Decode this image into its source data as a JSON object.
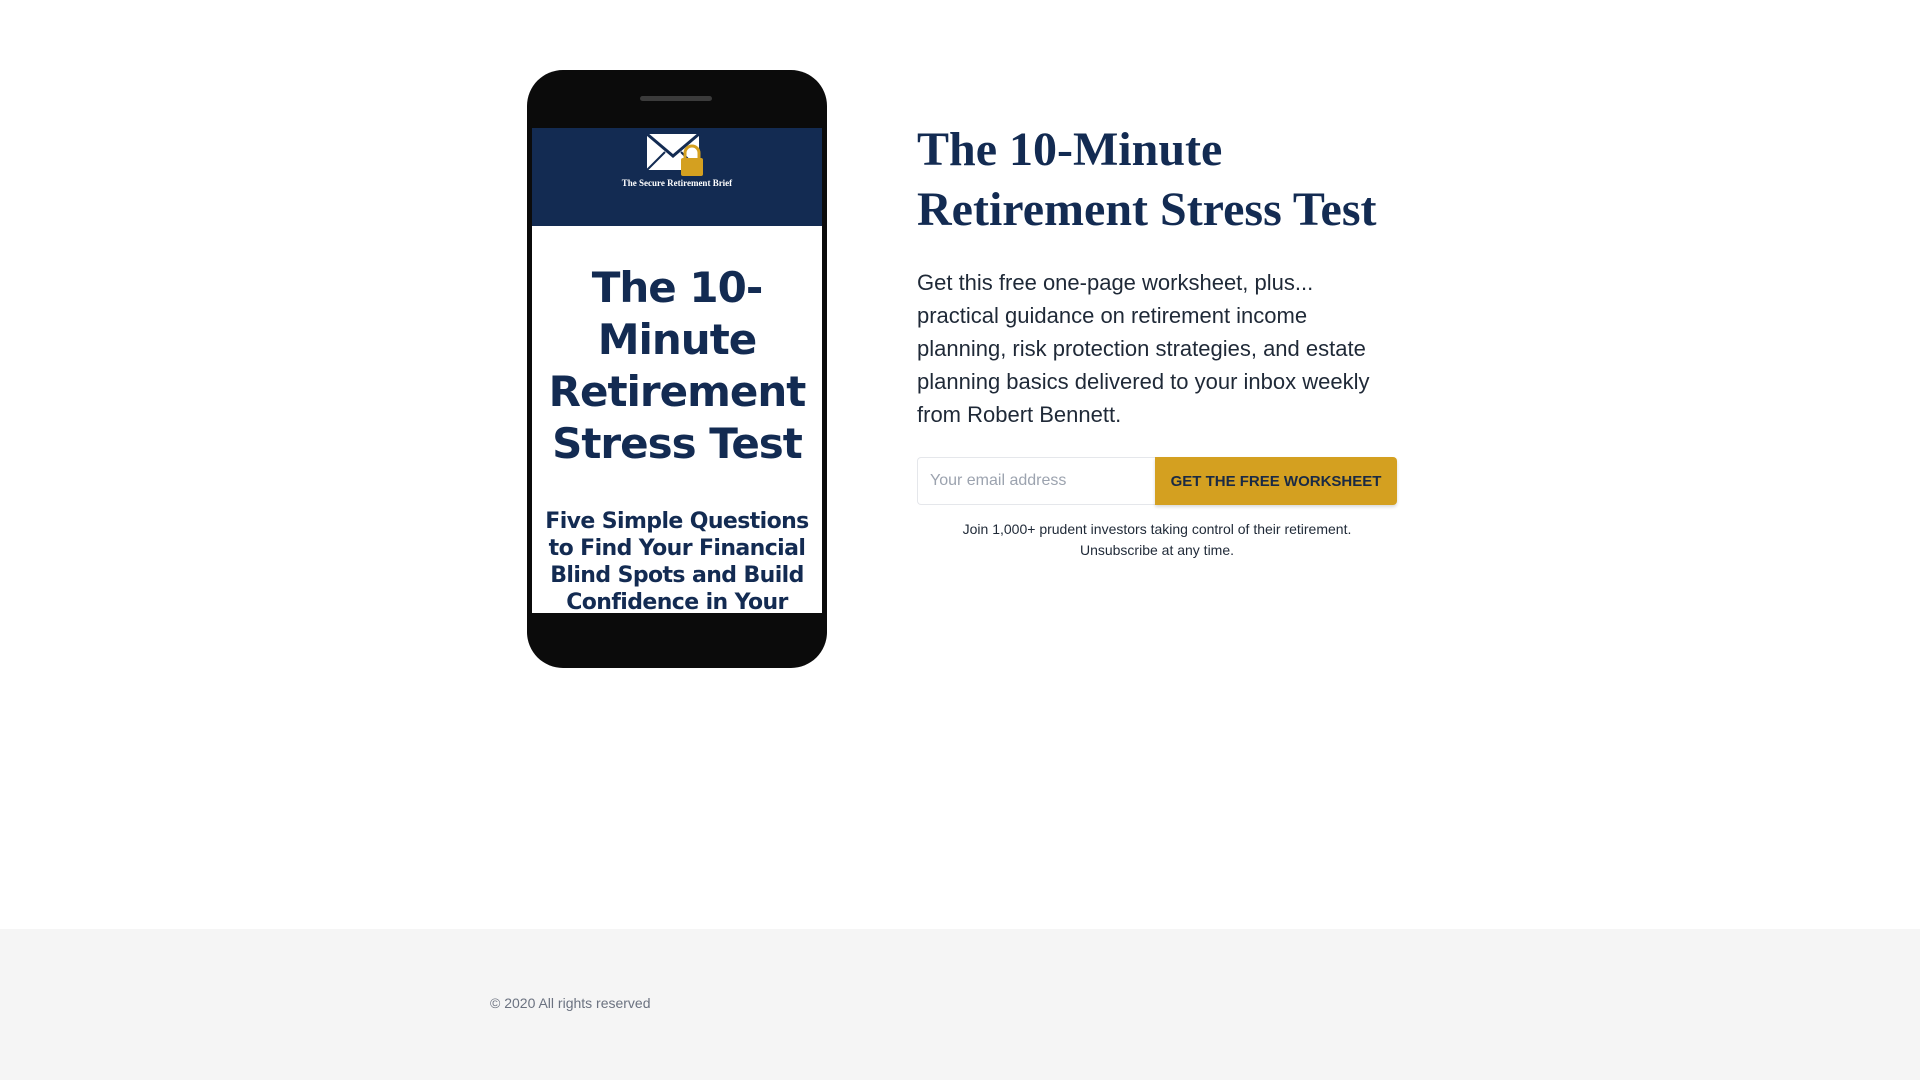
{
  "brand": {
    "logo_text": "The Secure Retirement Brief",
    "primary_color": "#132b52",
    "accent_color": "#d4a020"
  },
  "cover": {
    "title": "The 10-Minute Retirement Stress Test",
    "subtitle": "Five Simple Questions to Find Your Financial Blind Spots and Build Confidence in Your Plan"
  },
  "hero": {
    "headline": "The 10-Minute Retirement Stress Test",
    "description": "Get this free one-page worksheet, plus... practical guidance on retirement income planning, risk protection strategies, and estate planning basics delivered to your inbox weekly from Robert Bennett."
  },
  "form": {
    "email_placeholder": "Your email address",
    "email_value": "",
    "button_label": "GET THE FREE WORKSHEET",
    "note_line1": "Join 1,000+ prudent investors taking control of their retirement.",
    "note_line2": "Unsubscribe at any time."
  },
  "footer": {
    "copyright": "© 2020 All rights reserved"
  }
}
